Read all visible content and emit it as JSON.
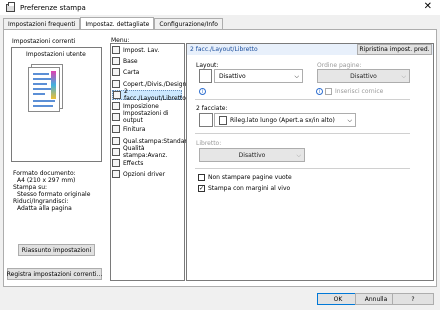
{
  "window": {
    "title": "Preferenze stampa"
  },
  "tabs": [
    {
      "label": "Impostazioni frequenti"
    },
    {
      "label": "Impostaz. dettagliate"
    },
    {
      "label": "Configurazione/Info"
    }
  ],
  "left": {
    "current_settings_label": "Impostazioni correnti",
    "user_settings_label": "Impostazioni utente",
    "info_lines": [
      "Formato documento:",
      "A4 (210 x 297 mm)",
      "Stampa su:",
      " Stesso formato originale",
      "Riduci/Ingrandisci:",
      " Adatta alla pagina"
    ],
    "summary_button": "Riassunto impostazioni",
    "register_button": "Registra impostazioni correnti..."
  },
  "menu": {
    "label": "Menu:",
    "items": [
      {
        "label": "Impost. Lav.",
        "icon": "job-settings-icon"
      },
      {
        "label": "Base",
        "icon": "basic-icon"
      },
      {
        "label": "Carta",
        "icon": "paper-icon"
      },
      {
        "label": "Copert./Divis./Designa",
        "icon": "cover-icon"
      },
      {
        "label": "2 facc./Layout/Libretto",
        "icon": "duplex-icon"
      },
      {
        "label": "Imposizione",
        "icon": "imposition-icon"
      },
      {
        "label": "Impostazioni di output",
        "icon": "output-icon"
      },
      {
        "label": "Finitura",
        "icon": "finishing-icon"
      },
      {
        "label": "Qual.stampa:Standard",
        "icon": "quality-icon"
      },
      {
        "label": "Qualità stampa:Avanz.",
        "icon": "quality-adv-icon"
      },
      {
        "label": "Effects",
        "icon": "effects-icon"
      },
      {
        "label": "Opzioni driver",
        "icon": "driver-options-icon"
      }
    ],
    "selected_index": 4
  },
  "panel": {
    "header": "2 facc./Layout/Libretto",
    "reset_button": "Ripristina impost. pred.",
    "layout_label": "Layout:",
    "layout_value": "Disattivo",
    "page_order_label": "Ordine pagine:",
    "page_order_value": "Disattivo",
    "insert_border_label": "Inserisci cornice",
    "duplex_label": "2 facciate:",
    "duplex_value": "Rileg.lato lungo (Apert.a sx/in alto)",
    "booklet_label": "Libretto:",
    "booklet_value": "Disattivo",
    "no_blank_label": "Non stampare pagine vuote",
    "borderless_label": "Stampa con margini al vivo",
    "borderless_checked": true
  },
  "footer": {
    "ok": "OK",
    "cancel": "Annulla",
    "help": "?"
  }
}
